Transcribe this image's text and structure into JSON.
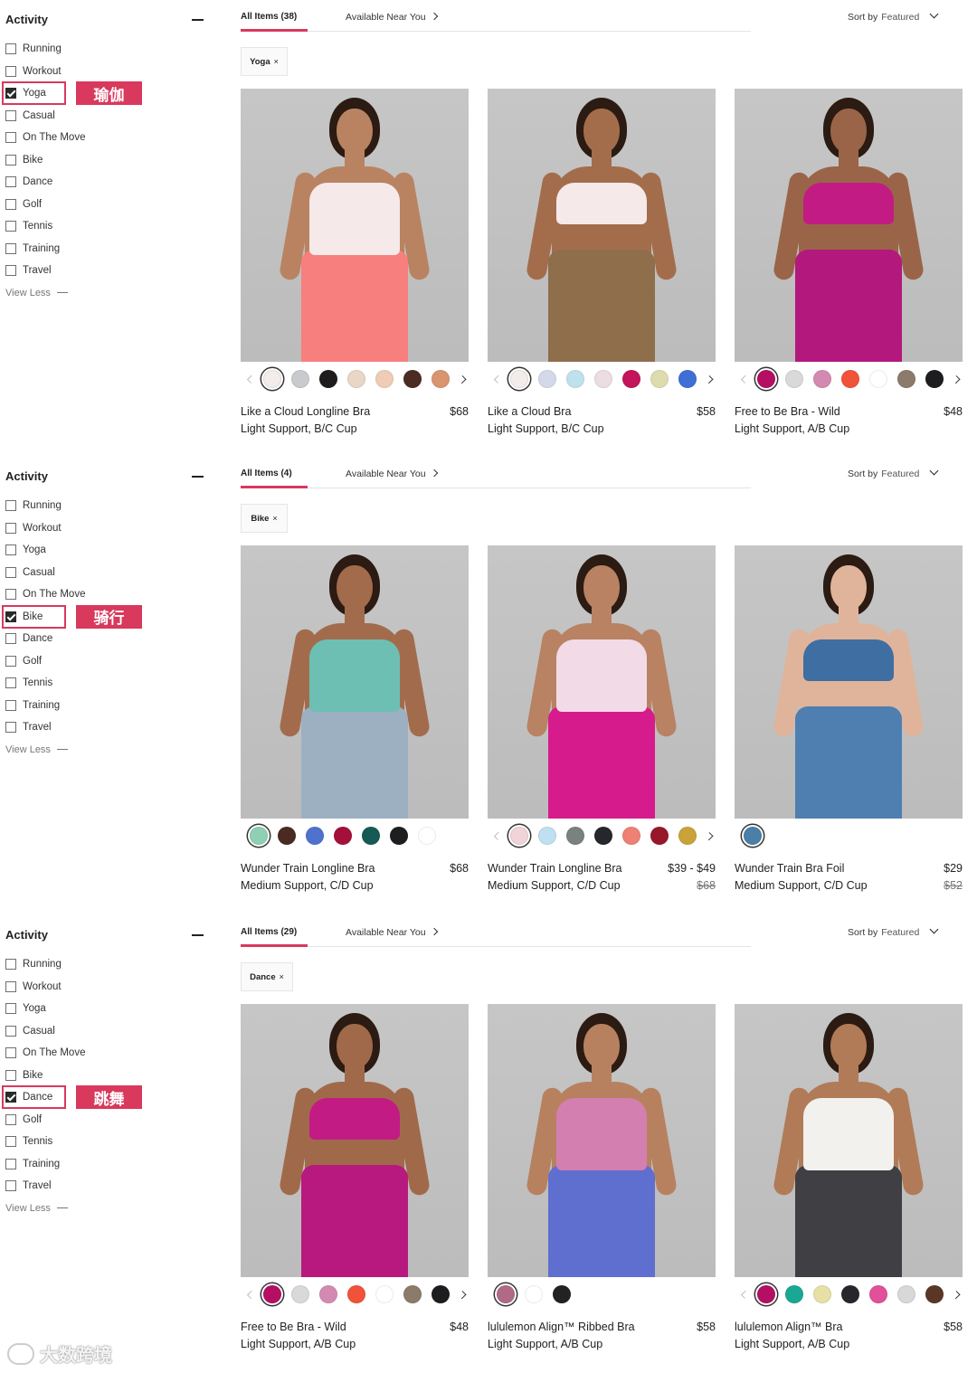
{
  "filters": [
    "Running",
    "Workout",
    "Yoga",
    "Casual",
    "On The Move",
    "Bike",
    "Dance",
    "Golf",
    "Tennis",
    "Training",
    "Travel"
  ],
  "sidebar_title": "Activity",
  "view_less": "View Less",
  "tab_near": "Available Near You",
  "sort_label": "Sort by",
  "sort_value": "Featured",
  "panels": [
    {
      "tab_all": "All Items (38)",
      "chip": "Yoga",
      "selected_index": 2,
      "tag_cn": "瑜伽",
      "products": [
        {
          "name": "Like a Cloud Longline Bra",
          "sub": "Light Support, B/C Cup",
          "price": "$68",
          "was": "",
          "top_color": "#f6e9ea",
          "bottom_color": "#f77f7d",
          "skin": "#b98361",
          "longtop": true,
          "has_left_arrow": true,
          "has_right_arrow": true,
          "swatches": [
            "#f4ecea",
            "#c8cacd",
            "#1e1c1c",
            "#e9d6c4",
            "#efccb6",
            "#4b2c22",
            "#d99470"
          ]
        },
        {
          "name": "Like a Cloud Bra",
          "sub": "Light Support, B/C Cup",
          "price": "$58",
          "was": "",
          "top_color": "#f6e9ea",
          "bottom_color": "#8f6e4c",
          "skin": "#a36d4c",
          "longtop": false,
          "has_left_arrow": true,
          "has_right_arrow": true,
          "swatches": [
            "#f2eceb",
            "#d4d9ea",
            "#bfe1ee",
            "#ecdde3",
            "#c3145c",
            "#dedcae",
            "#3f6fd4"
          ]
        },
        {
          "name": "Free to Be Bra - Wild",
          "sub": "Light Support, A/B Cup",
          "price": "$48",
          "was": "",
          "top_color": "#c31b84",
          "bottom_color": "#b3187c",
          "skin": "#9a6448",
          "longtop": false,
          "has_left_arrow": true,
          "has_right_arrow": true,
          "swatches": [
            "#b50f63",
            "#d9d9d9",
            "#d48ab0",
            "#f1523a",
            "#ffffff",
            "#8c7b6a",
            "#1d1d1f"
          ]
        }
      ]
    },
    {
      "tab_all": "All Items (4)",
      "chip": "Bike",
      "selected_index": 5,
      "tag_cn": "骑行",
      "products": [
        {
          "name": "Wunder Train Longline Bra",
          "sub": "Medium Support, C/D Cup",
          "price": "$68",
          "was": "",
          "top_color": "#6dbfb3",
          "bottom_color": "#9db0c2",
          "skin": "#a26c4c",
          "longtop": true,
          "has_left_arrow": false,
          "has_right_arrow": false,
          "swatches": [
            "#8fd0b4",
            "#4a2a22",
            "#4f72cf",
            "#a5103a",
            "#155a55",
            "#1e1e20",
            "#ffffff"
          ]
        },
        {
          "name": "Wunder Train Longline Bra",
          "sub": "Medium Support, C/D Cup",
          "price": "$39 - $49",
          "was": "$68",
          "top_color": "#f2dbe6",
          "bottom_color": "#d61b8c",
          "skin": "#b88263",
          "longtop": true,
          "has_left_arrow": true,
          "has_right_arrow": true,
          "swatches": [
            "#f1d4d8",
            "#bfe0f0",
            "#7a827e",
            "#25272c",
            "#ee8074",
            "#98182b",
            "#c9a33a"
          ]
        },
        {
          "name": "Wunder Train Bra Foil",
          "sub": "Medium Support, C/D Cup",
          "price": "$29",
          "was": "$52",
          "top_color": "#3f6ea3",
          "bottom_color": "#4f7fb0",
          "skin": "#e0b49a",
          "longtop": false,
          "has_left_arrow": false,
          "has_right_arrow": false,
          "swatches": [
            "#4b7fa8"
          ]
        }
      ]
    },
    {
      "tab_all": "All Items (29)",
      "chip": "Dance",
      "selected_index": 6,
      "tag_cn": "跳舞",
      "products": [
        {
          "name": "Free to Be Bra - Wild",
          "sub": "Light Support, A/B Cup",
          "price": "$48",
          "was": "",
          "top_color": "#c31b84",
          "bottom_color": "#b8197e",
          "skin": "#a06a4a",
          "longtop": false,
          "has_left_arrow": true,
          "has_right_arrow": true,
          "swatches": [
            "#b50f63",
            "#d9d9d9",
            "#d48ab0",
            "#f1523a",
            "#ffffff",
            "#8c7b6a",
            "#1d1d1f"
          ]
        },
        {
          "name": "lululemon Align™ Ribbed Bra",
          "sub": "Light Support, A/B Cup",
          "price": "$58",
          "was": "",
          "top_color": "#d37fb0",
          "bottom_color": "#5f6fcf",
          "skin": "#b78160",
          "longtop": true,
          "has_left_arrow": false,
          "has_right_arrow": false,
          "swatches": [
            "#b06a86",
            "#ffffff",
            "#222222"
          ]
        },
        {
          "name": "lululemon Align™ Bra",
          "sub": "Light Support, A/B Cup",
          "price": "$58",
          "was": "",
          "top_color": "#f3f1ee",
          "bottom_color": "#3f3f44",
          "skin": "#b17b58",
          "longtop": true,
          "has_left_arrow": true,
          "has_right_arrow": true,
          "swatches": [
            "#b50f63",
            "#1aa894",
            "#e6e0a6",
            "#26272c",
            "#e1509a",
            "#d8d8d8",
            "#5a3626"
          ]
        }
      ]
    }
  ],
  "watermark": "大数跨境",
  "accent_color": "#d8395d"
}
